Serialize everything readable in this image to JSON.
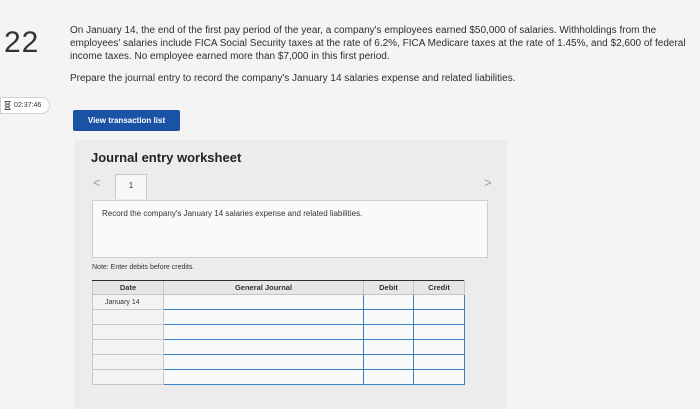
{
  "question": {
    "number": "22",
    "paragraph1": "On January 14, the end of the first pay period of the year, a company's employees earned $50,000 of salaries. Withholdings from the employees' salaries include FICA Social Security taxes at the rate of 6.2%, FICA Medicare taxes at the rate of 1.45%, and $2,600 of federal income taxes. No employee earned more than $7,000 in this first period.",
    "paragraph2": "Prepare the journal entry to record the company's January 14 salaries expense and related liabilities."
  },
  "timer": {
    "time": "02:37:46"
  },
  "buttons": {
    "view_transaction_list": "View transaction list"
  },
  "worksheet": {
    "title": "Journal entry worksheet",
    "prev": "<",
    "next": ">",
    "page": "1",
    "instruction": "Record the company's January 14 salaries expense and related liabilities.",
    "note": "Note: Enter debits before credits.",
    "columns": [
      "Date",
      "General Journal",
      "Debit",
      "Credit"
    ],
    "rows": [
      {
        "date": "January 14"
      },
      {
        "date": ""
      },
      {
        "date": ""
      },
      {
        "date": ""
      },
      {
        "date": ""
      },
      {
        "date": ""
      }
    ]
  }
}
